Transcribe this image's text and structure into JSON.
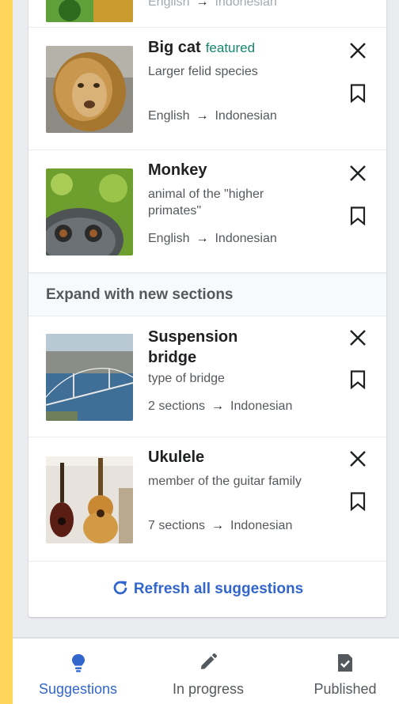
{
  "items": [
    {
      "title": "",
      "description": "",
      "lang_from": "English",
      "lang_to": "Indonesian",
      "thumb": "greenery-thumbnail"
    },
    {
      "title": "Big cat",
      "badge": "featured",
      "description": "Larger felid species",
      "lang_from": "English",
      "lang_to": "Indonesian",
      "thumb": "lion-thumbnail"
    },
    {
      "title": "Monkey",
      "description": "animal of the \"higher primates\"",
      "lang_from": "English",
      "lang_to": "Indonesian",
      "thumb": "monkey-thumbnail"
    }
  ],
  "section_header": "Expand with new sections",
  "expand_items": [
    {
      "title": "Suspension bridge",
      "description": "type of bridge",
      "sections": "2 sections",
      "lang_to": "Indonesian",
      "thumb": "bridge-thumbnail"
    },
    {
      "title": "Ukulele",
      "description": "member of the guitar family",
      "sections": "7 sections",
      "lang_to": "Indonesian",
      "thumb": "ukulele-thumbnail"
    }
  ],
  "refresh_label": "Refresh all suggestions",
  "nav": {
    "suggestions": "Suggestions",
    "in_progress": "In progress",
    "published": "Published"
  },
  "colors": {
    "accent": "#3366CC",
    "featured": "#14866D",
    "frame": "#FFD65A"
  },
  "icons": {
    "close": "close-icon",
    "bookmark": "bookmark-icon",
    "arrow": "arrow-right-icon",
    "refresh": "refresh-icon",
    "suggestions": "lightbulb-icon",
    "in_progress": "pencil-icon",
    "published": "document-check-icon"
  }
}
